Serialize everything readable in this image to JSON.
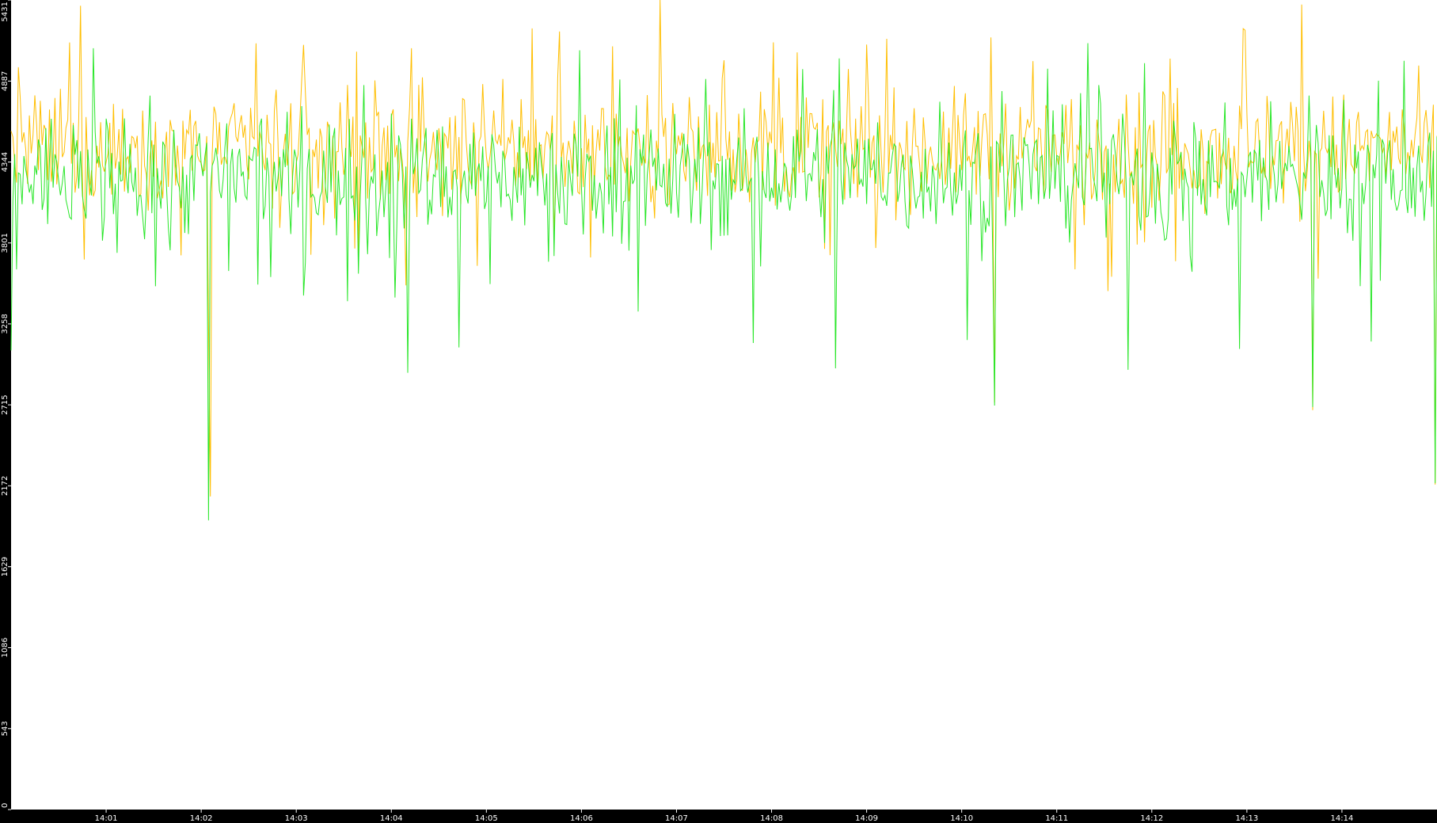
{
  "chart_data": {
    "type": "line",
    "title": "",
    "xlabel": "",
    "ylabel": "",
    "ylim": [
      0,
      5431
    ],
    "y_ticks": [
      "0",
      "543",
      "1086",
      "1629",
      "2172",
      "2715",
      "3258",
      "3801",
      "4344",
      "4887",
      "5431"
    ],
    "x_range_minutes": [
      "14:00",
      "14:15"
    ],
    "x_ticks": [
      "14:01",
      "14:02",
      "14:03",
      "14:04",
      "14:05",
      "14:06",
      "14:07",
      "14:08",
      "14:09",
      "14:10",
      "14:11",
      "14:12",
      "14:13",
      "14:14"
    ],
    "grid": false,
    "legend": "none",
    "series": [
      {
        "color": "#ffbe00",
        "baseline": 4430,
        "spread": 260,
        "samples_per_minute": 52,
        "points": [
          [
            "14:00:05",
            4980
          ],
          [
            "14:00:44",
            5393
          ],
          [
            "14:02:05",
            3250
          ],
          [
            "14:02:06",
            2100
          ],
          [
            "14:02:35",
            5140
          ],
          [
            "14:03:05",
            5130
          ],
          [
            "14:05:29",
            5240
          ],
          [
            "14:06:50",
            5431
          ],
          [
            "14:08:16",
            5080
          ],
          [
            "14:10:18",
            5180
          ],
          [
            "14:10:21",
            2730
          ],
          [
            "14:13:35",
            5400
          ],
          [
            "14:13:41",
            2680
          ],
          [
            "14:14:59",
            2180
          ]
        ]
      },
      {
        "color": "#28e628",
        "baseline": 4250,
        "spread": 280,
        "samples_per_minute": 52,
        "points": [
          [
            "14:00:00",
            3080
          ],
          [
            "14:02:05",
            1940
          ],
          [
            "14:04:10",
            2930
          ],
          [
            "14:04:43",
            3100
          ],
          [
            "14:07:48",
            3130
          ],
          [
            "14:08:40",
            2960
          ],
          [
            "14:10:03",
            3150
          ],
          [
            "14:10:21",
            2710
          ],
          [
            "14:11:45",
            2950
          ],
          [
            "14:12:55",
            3090
          ],
          [
            "14:13:41",
            2700
          ],
          [
            "14:14:18",
            3140
          ],
          [
            "14:14:59",
            2190
          ]
        ]
      }
    ]
  }
}
